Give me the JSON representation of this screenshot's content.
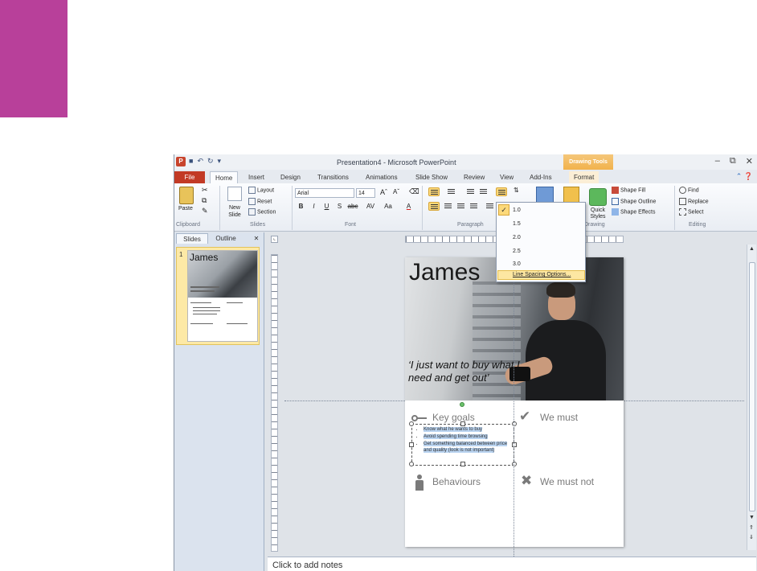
{
  "accent_color": "#b8409a",
  "window": {
    "title": "Presentation4 - Microsoft PowerPoint",
    "contextual_tab": "Drawing Tools",
    "app_letter": "P"
  },
  "tabs": [
    "File",
    "Home",
    "Insert",
    "Design",
    "Transitions",
    "Animations",
    "Slide Show",
    "Review",
    "View",
    "Add-Ins",
    "Format"
  ],
  "ribbon": {
    "clipboard": {
      "paste": "Paste",
      "label": "Clipboard"
    },
    "slides": {
      "new_slide": "New Slide",
      "layout": "Layout",
      "reset": "Reset",
      "section": "Section",
      "label": "Slides"
    },
    "font": {
      "family": "Arial",
      "size": "14",
      "label": "Font",
      "bold": "B",
      "italic": "I",
      "underline": "U",
      "shadow": "S",
      "strike": "abc",
      "spacing": "AV",
      "case": "Aa",
      "color": "A"
    },
    "paragraph": {
      "label": "Paragraph"
    },
    "drawing": {
      "shape_fill": "Shape Fill",
      "shape_outline": "Shape Outline",
      "shape_effects": "Shape Effects",
      "quick_styles": "Quick Styles",
      "label": "Drawing"
    },
    "editing": {
      "find": "Find",
      "replace": "Replace",
      "select": "Select",
      "label": "Editing"
    }
  },
  "line_spacing_menu": {
    "options": [
      "1.0",
      "1.5",
      "2.0",
      "2.5",
      "3.0"
    ],
    "selected": "1.0",
    "more": "Line Spacing Options..."
  },
  "panel": {
    "tabs": [
      "Slides",
      "Outline"
    ],
    "slide_number": "1",
    "thumb_title": "James"
  },
  "slide": {
    "name": "James",
    "quote": "‘I just want to buy what I need and get out’",
    "sections": {
      "key_goals": "Key goals",
      "we_must": "We must",
      "behaviours": "Behaviours",
      "we_must_not": "We must not"
    },
    "bullets": [
      "Know what he wants to buy",
      "Avoid spending time browsing",
      "Get something balanced between price and quality (look is not important)"
    ]
  },
  "notes_placeholder": "Click to add notes"
}
